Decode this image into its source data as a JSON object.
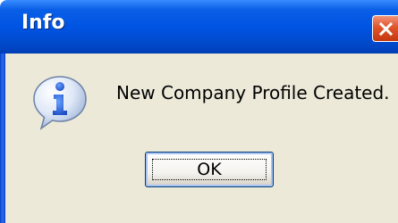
{
  "dialog": {
    "title": "Info",
    "message": "New Company Profile Created.",
    "ok_label": "OK"
  },
  "icons": {
    "status": "information-icon",
    "close": "close-icon"
  },
  "colors": {
    "titlebar": "#0054e3",
    "close_button": "#e0542a",
    "body": "#ece9d8",
    "info_icon": "#2f6de0"
  }
}
